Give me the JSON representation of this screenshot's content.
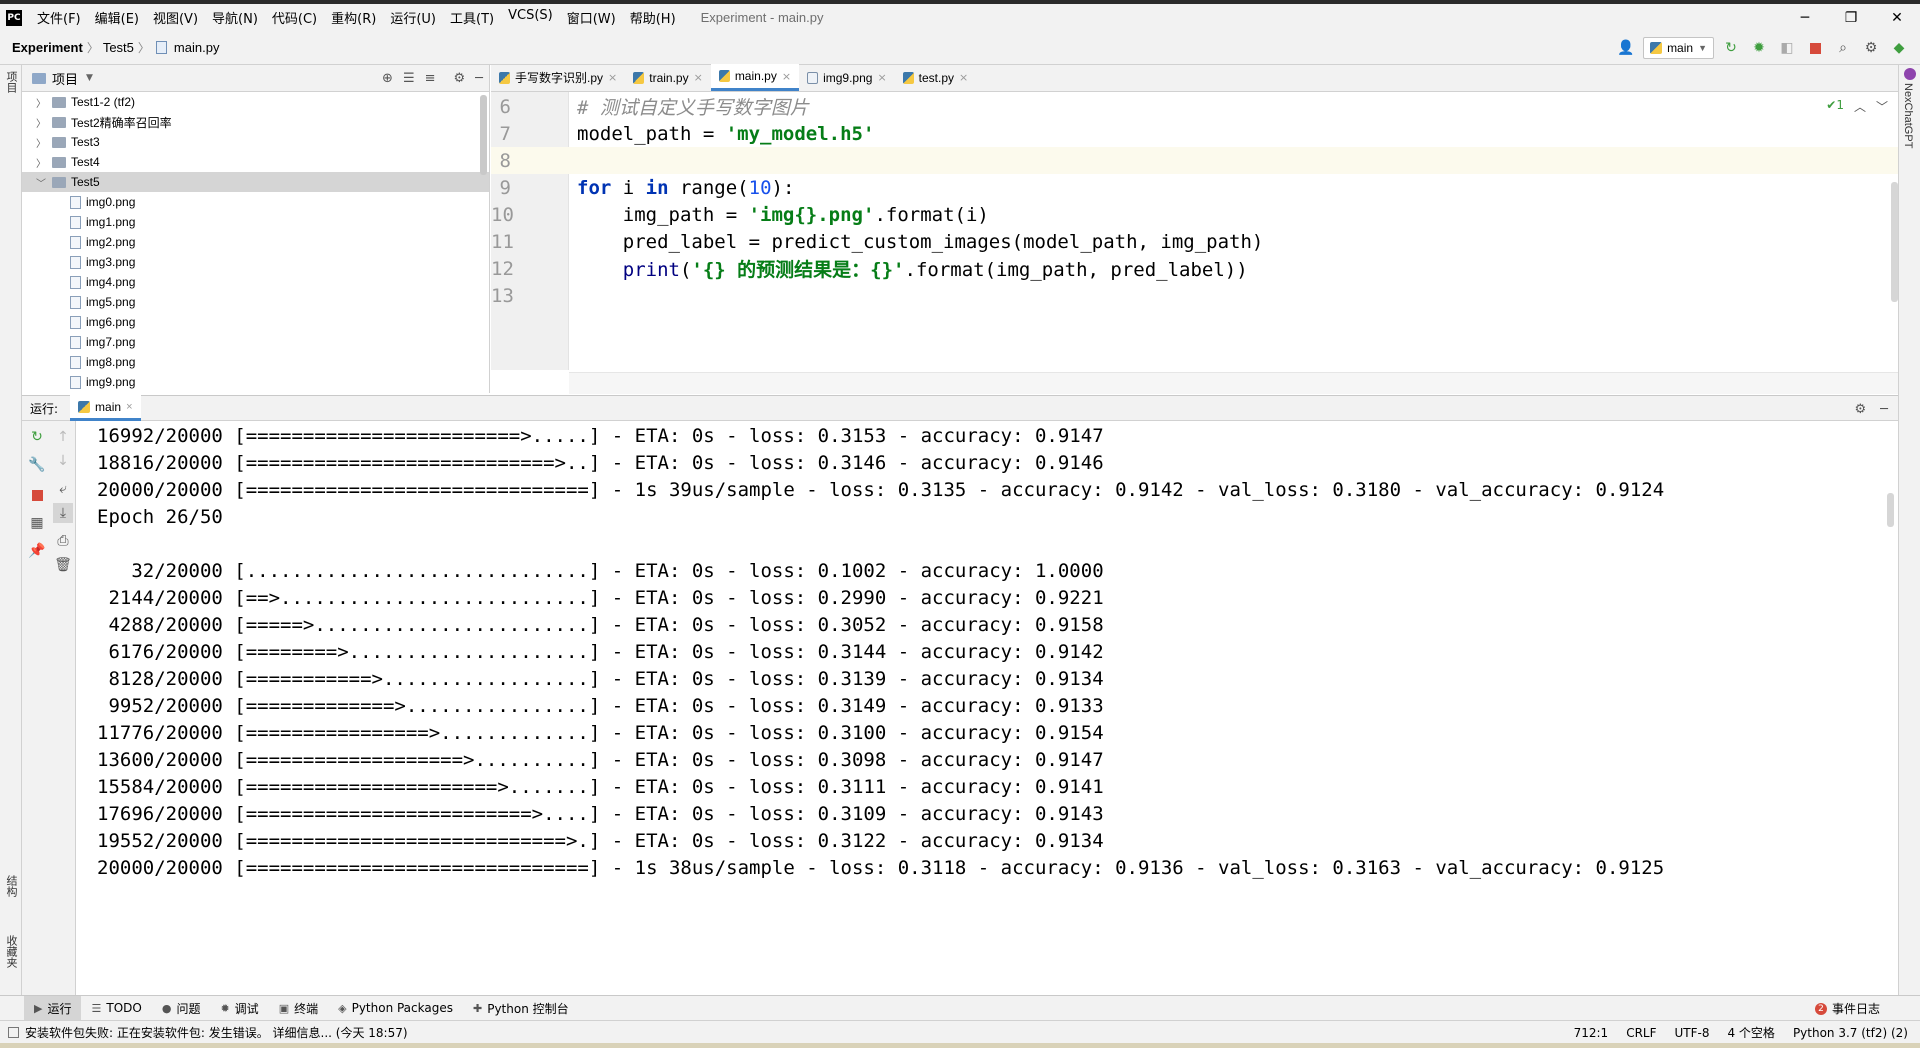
{
  "menubar": {
    "logo": "PC",
    "items": [
      "文件(F)",
      "编辑(E)",
      "视图(V)",
      "导航(N)",
      "代码(C)",
      "重构(R)",
      "运行(U)",
      "工具(T)",
      "VCS(S)",
      "窗口(W)",
      "帮助(H)"
    ],
    "title": "Experiment - main.py",
    "minimize": "─",
    "restore": "❐",
    "close": "✕"
  },
  "navbar": {
    "crumbs": [
      "Experiment",
      "Test5",
      "main.py"
    ],
    "run_config": "main",
    "icons": [
      "user-icon",
      "run-icon",
      "debug-icon",
      "coverage-icon",
      "stop-icon",
      "search-icon",
      "settings-icon",
      "update-icon"
    ]
  },
  "left_strip": {
    "top_tab": "项目",
    "structure_tab": "结构",
    "favorites_tab": "收藏夹"
  },
  "right_strip": {
    "tab": "NexChatGPT"
  },
  "project": {
    "header": "项目",
    "tree": [
      {
        "label": "Test1-2  (tf2)",
        "kind": "folder",
        "expanded": false,
        "depth": 1
      },
      {
        "label": "Test2精确率召回率",
        "kind": "folder",
        "expanded": false,
        "depth": 1
      },
      {
        "label": "Test3",
        "kind": "folder",
        "expanded": false,
        "depth": 1
      },
      {
        "label": "Test4",
        "kind": "folder",
        "expanded": false,
        "depth": 1
      },
      {
        "label": "Test5",
        "kind": "folder",
        "expanded": true,
        "depth": 1,
        "selected": true
      },
      {
        "label": "img0.png",
        "kind": "png",
        "depth": 2
      },
      {
        "label": "img1.png",
        "kind": "png",
        "depth": 2
      },
      {
        "label": "img2.png",
        "kind": "png",
        "depth": 2
      },
      {
        "label": "img3.png",
        "kind": "png",
        "depth": 2
      },
      {
        "label": "img4.png",
        "kind": "png",
        "depth": 2
      },
      {
        "label": "img5.png",
        "kind": "png",
        "depth": 2
      },
      {
        "label": "img6.png",
        "kind": "png",
        "depth": 2
      },
      {
        "label": "img7.png",
        "kind": "png",
        "depth": 2
      },
      {
        "label": "img8.png",
        "kind": "png",
        "depth": 2
      },
      {
        "label": "img9.png",
        "kind": "png",
        "depth": 2
      }
    ]
  },
  "editor": {
    "tabs": [
      {
        "label": "手写数字识别.py",
        "kind": "py",
        "active": false
      },
      {
        "label": "train.py",
        "kind": "py",
        "active": false
      },
      {
        "label": "main.py",
        "kind": "py",
        "active": true
      },
      {
        "label": "img9.png",
        "kind": "img",
        "active": false
      },
      {
        "label": "test.py",
        "kind": "py",
        "active": false
      }
    ],
    "inspection_count": "1",
    "lines": [
      {
        "num": "6",
        "tokens": [
          [
            "c-cmt",
            "# 测试自定义手写数字图片"
          ]
        ]
      },
      {
        "num": "7",
        "tokens": [
          [
            "",
            "model_path = "
          ],
          [
            "c-str",
            "'my_model.h5'"
          ]
        ]
      },
      {
        "num": "8",
        "tokens": [
          [
            "",
            ""
          ]
        ],
        "current": true
      },
      {
        "num": "9",
        "tokens": [
          [
            "c-kw",
            "for"
          ],
          [
            "",
            " i "
          ],
          [
            "c-kw",
            "in"
          ],
          [
            "",
            " range("
          ],
          [
            "c-num",
            "10"
          ],
          [
            "",
            "):"
          ]
        ]
      },
      {
        "num": "10",
        "tokens": [
          [
            "",
            "    img_path = "
          ],
          [
            "c-str",
            "'img{}.png'"
          ],
          [
            "",
            ".format(i)"
          ]
        ]
      },
      {
        "num": "11",
        "tokens": [
          [
            "",
            "    pred_label = predict_custom_images(model_path, img_path)"
          ]
        ]
      },
      {
        "num": "12",
        "tokens": [
          [
            "",
            "    "
          ],
          [
            "c-fn",
            "print"
          ],
          [
            "",
            "("
          ],
          [
            "c-str",
            "'{} 的预测结果是：{}'"
          ],
          [
            "",
            ".format(img_path, pred_label))"
          ]
        ]
      },
      {
        "num": "13",
        "tokens": [
          [
            "",
            ""
          ]
        ]
      }
    ]
  },
  "run": {
    "label": "运行:",
    "tab": "main",
    "console": [
      "16992/20000 [========================>.....] - ETA: 0s - loss: 0.3153 - accuracy: 0.9147",
      "18816/20000 [===========================>..] - ETA: 0s - loss: 0.3146 - accuracy: 0.9146",
      "20000/20000 [==============================] - 1s 39us/sample - loss: 0.3135 - accuracy: 0.9142 - val_loss: 0.3180 - val_accuracy: 0.9124",
      "Epoch 26/50",
      "",
      "   32/20000 [..............................] - ETA: 0s - loss: 0.1002 - accuracy: 1.0000",
      " 2144/20000 [==>...........................] - ETA: 0s - loss: 0.2990 - accuracy: 0.9221",
      " 4288/20000 [=====>........................] - ETA: 0s - loss: 0.3052 - accuracy: 0.9158",
      " 6176/20000 [========>.....................] - ETA: 0s - loss: 0.3144 - accuracy: 0.9142",
      " 8128/20000 [===========>..................] - ETA: 0s - loss: 0.3139 - accuracy: 0.9134",
      " 9952/20000 [=============>................] - ETA: 0s - loss: 0.3149 - accuracy: 0.9133",
      "11776/20000 [================>.............] - ETA: 0s - loss: 0.3100 - accuracy: 0.9154",
      "13600/20000 [===================>..........] - ETA: 0s - loss: 0.3098 - accuracy: 0.9147",
      "15584/20000 [======================>.......] - ETA: 0s - loss: 0.3111 - accuracy: 0.9141",
      "17696/20000 [=========================>....] - ETA: 0s - loss: 0.3109 - accuracy: 0.9143",
      "19552/20000 [============================>.] - ETA: 0s - loss: 0.3122 - accuracy: 0.9134",
      "20000/20000 [==============================] - 1s 38us/sample - loss: 0.3118 - accuracy: 0.9136 - val_loss: 0.3163 - val_accuracy: 0.9125"
    ]
  },
  "bottombar": {
    "tabs": [
      {
        "label": "运行",
        "icon": "▶",
        "active": true
      },
      {
        "label": "TODO",
        "icon": "☰",
        "active": false
      },
      {
        "label": "问题",
        "icon": "●",
        "active": false
      },
      {
        "label": "调试",
        "icon": "✹",
        "active": false
      },
      {
        "label": "终端",
        "icon": "▣",
        "active": false
      },
      {
        "label": "Python Packages",
        "icon": "◈",
        "active": false
      },
      {
        "label": "Python 控制台",
        "icon": "✚",
        "active": false
      }
    ],
    "event_log": "事件日志",
    "event_count": "2"
  },
  "statusbar": {
    "message": "安装软件包失败: 正在安装软件包: 发生错误。 详细信息... (今天 18:57)",
    "position": "712:1",
    "line_sep": "CRLF",
    "encoding": "UTF-8",
    "indent": "4 个空格",
    "interpreter": "Python 3.7 (tf2) (2)"
  }
}
